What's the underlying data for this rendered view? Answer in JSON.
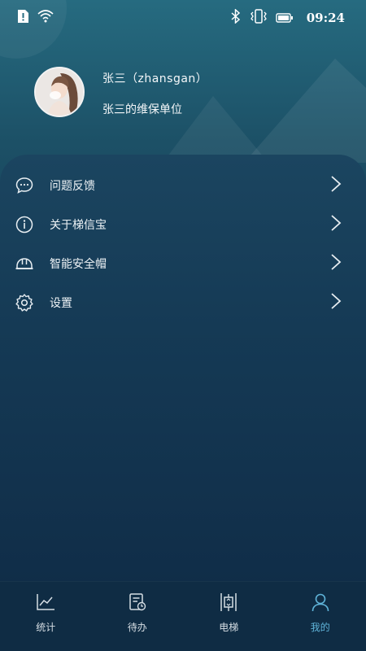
{
  "status_bar": {
    "time": "09:24",
    "icons": [
      "sim-alert-icon",
      "wifi-icon",
      "bluetooth-icon",
      "vibrate-icon",
      "battery-icon"
    ]
  },
  "profile": {
    "name": "张三（zhansgan）",
    "unit": "张三的维保单位"
  },
  "menu": {
    "items": [
      {
        "label": "问题反馈",
        "icon": "chat-bubble-icon"
      },
      {
        "label": "关于梯信宝",
        "icon": "info-icon"
      },
      {
        "label": "智能安全帽",
        "icon": "helmet-icon"
      },
      {
        "label": "设置",
        "icon": "gear-icon"
      }
    ]
  },
  "tabbar": {
    "tabs": [
      {
        "label": "统计",
        "icon": "chart-icon"
      },
      {
        "label": "待办",
        "icon": "todo-icon"
      },
      {
        "label": "电梯",
        "icon": "elevator-icon"
      },
      {
        "label": "我的",
        "icon": "user-icon",
        "active": true
      }
    ]
  },
  "colors": {
    "accent": "#5fb3d8",
    "background_top": "#266b80",
    "background_bottom": "#112f49",
    "tabbar": "#0f2c44"
  }
}
